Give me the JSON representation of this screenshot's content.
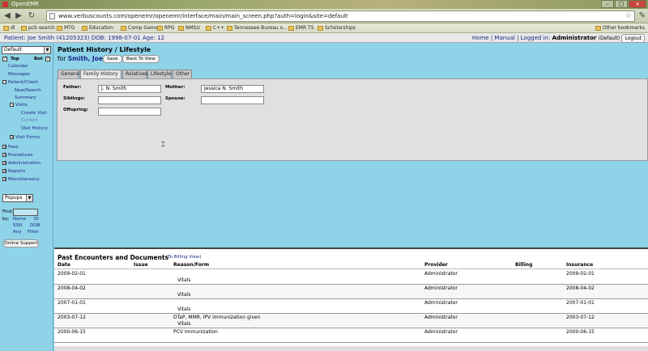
{
  "browser": {
    "tab_title": "OpenEMR",
    "url": "www.verbuscounts.com/openemr/openemr/interface/main/main_screen.php?auth=login&site=default",
    "bookmarks": [
      "dl",
      "pcb search",
      "MTG",
      "Education",
      "Comp Game",
      "RPG",
      "NMSU",
      "C++",
      "Tennessee Bureau o...",
      "EMR TS",
      "Scholarships"
    ],
    "other_bookmarks": "Other bookmarks"
  },
  "appbar": {
    "patient_info": "Patient: Joe Smith (41205323) DOB: 1998-07-01 Age: 12",
    "home": "Home",
    "manual": "Manual",
    "logged_in_prefix": "Logged in:",
    "user": "Administrator",
    "site": "(Default)",
    "logout": "Logout"
  },
  "leftnav": {
    "view_select": "Default",
    "top_label": "Top",
    "bot_label": "Bot",
    "items": {
      "calendar": "Calendar",
      "messages": "Messages",
      "patient_client": "Patient/Client",
      "new_search": "New/Search",
      "summary": "Summary",
      "visits": "Visits",
      "create_visit": "Create Visit",
      "current": "Current",
      "visit_history": "Visit History",
      "visit_forms": "Visit Forms",
      "fees": "Fees",
      "procedures": "Procedures",
      "administration": "Administration",
      "reports": "Reports",
      "miscellaneous": "Miscellaneous"
    },
    "popups_select": "Popups",
    "find_label": "Find:",
    "by_label": "by:",
    "find_options": [
      "Name",
      "ID",
      "SSN",
      "DOB",
      "Any",
      "Filter"
    ],
    "online_support": "Online Support"
  },
  "main": {
    "title": "Patient History / Lifestyle",
    "for_prefix": "for",
    "patient_name": "Smith, Joe",
    "save_label": "Save",
    "back_label": "Back To View",
    "tabs": [
      "General",
      "Family History",
      "Relatives",
      "Lifestyle",
      "Other"
    ],
    "active_tab": "Family History",
    "fields": {
      "father_label": "Father:",
      "father_value": "J. N. Smith",
      "mother_label": "Mother:",
      "mother_value": "Jessica N. Smith",
      "siblings_label": "Siblings:",
      "siblings_value": "",
      "spouse_label": "Spouse:",
      "spouse_value": "",
      "offspring_label": "Offspring:",
      "offspring_value": ""
    }
  },
  "encounters": {
    "title": "Past Encounters and Documents",
    "billing_view_link": "(To Billing View)",
    "columns": [
      "Date",
      "Issue",
      "Reason/Form",
      "Provider",
      "Billing",
      "Insurance"
    ],
    "rows": [
      {
        "date": "2009-02-01",
        "issue": "",
        "reason": "",
        "form": "Vitals",
        "provider": "Administrator",
        "billing": "",
        "insurance": "2009-02-01"
      },
      {
        "date": "2008-04-02",
        "issue": "",
        "reason": "",
        "form": "Vitals",
        "provider": "Administrator",
        "billing": "",
        "insurance": "2008-04-02"
      },
      {
        "date": "2007-01-01",
        "issue": "",
        "reason": "",
        "form": "Vitals",
        "provider": "Administrator",
        "billing": "",
        "insurance": "2007-01-01"
      },
      {
        "date": "2003-07-12",
        "issue": "",
        "reason": "DTaP, MMR, IPV immunization given",
        "form": "Vitals",
        "provider": "Administrator",
        "billing": "",
        "insurance": "2003-07-12"
      },
      {
        "date": "2000-06-15",
        "issue": "",
        "reason": "PCV Immunization",
        "form": "",
        "provider": "Administrator",
        "billing": "",
        "insurance": "2000-06-15"
      }
    ]
  }
}
